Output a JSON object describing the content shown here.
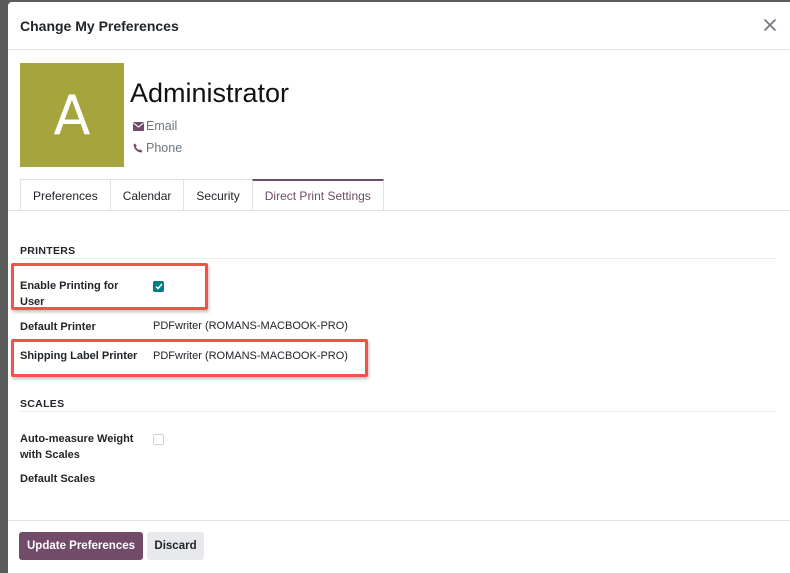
{
  "dialog": {
    "title": "Change My Preferences"
  },
  "user": {
    "avatar_letter": "A",
    "name": "Administrator",
    "email_label": "Email",
    "phone_label": "Phone",
    "avatar_color": "#a6a43c"
  },
  "tabs": [
    {
      "label": "Preferences"
    },
    {
      "label": "Calendar"
    },
    {
      "label": "Security"
    },
    {
      "label": "Direct Print Settings",
      "active": true
    }
  ],
  "printers": {
    "section_title": "PRINTERS",
    "enable_label": "Enable Printing for User",
    "enable_checked": true,
    "default_printer_label": "Default Printer",
    "default_printer_value": "PDFwriter (ROMANS-MACBOOK-PRO)",
    "shipping_label": "Shipping Label Printer",
    "shipping_value": "PDFwriter (ROMANS-MACBOOK-PRO)"
  },
  "scales": {
    "section_title": "SCALES",
    "auto_measure_label": "Auto-measure Weight with Scales",
    "auto_measure_checked": false,
    "default_scales_label": "Default Scales"
  },
  "footer": {
    "update_label": "Update Preferences",
    "discard_label": "Discard"
  },
  "colors": {
    "accent": "#714b67",
    "checkbox": "#017e84",
    "highlight": "#f2524a"
  }
}
